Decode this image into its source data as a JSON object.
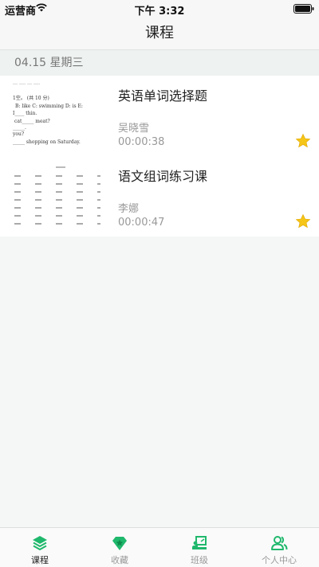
{
  "status_bar": {
    "carrier": "运营商",
    "time": "下午 3:32"
  },
  "nav": {
    "title": "课程"
  },
  "section": {
    "date_label": "04.15 星期三"
  },
  "courses": [
    {
      "title": "英语单词选择题",
      "teacher": "吴晓雪",
      "duration": "00:00:38",
      "favorite_icon": "star-icon"
    },
    {
      "title": "语文组词练习课",
      "teacher": "李娜",
      "duration": "00:00:47",
      "favorite_icon": "star-icon"
    }
  ],
  "thumb_text": {
    "english_lines": [
      "1空。 (共 10 分)",
      "B: like    C: swimming    D: is    E:",
      "I____ thin.",
      "cat_____ meat?",
      "_____.",
      "you?",
      "_____ shopping on Saturday."
    ]
  },
  "tab_bar": {
    "tabs": [
      {
        "label": "课程",
        "icon": "layers-icon",
        "active": true
      },
      {
        "label": "收藏",
        "icon": "star-badge-icon",
        "active": false
      },
      {
        "label": "班级",
        "icon": "classroom-icon",
        "active": false
      },
      {
        "label": "个人中心",
        "icon": "user-group-icon",
        "active": false
      }
    ]
  },
  "colors": {
    "accent": "#1fb86c",
    "star": "#f5c518",
    "tab_inactive": "#999999"
  }
}
